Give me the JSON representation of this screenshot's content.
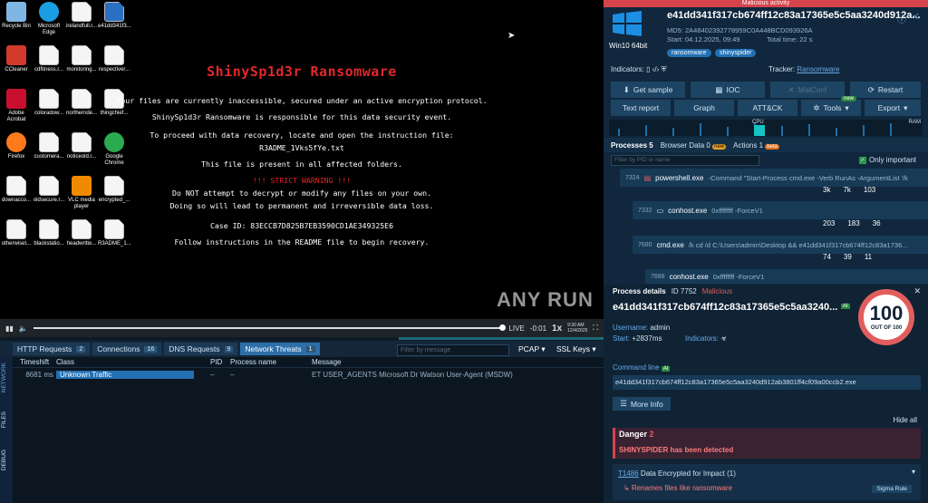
{
  "vm": {
    "icons": [
      {
        "label": "Recycle Bin",
        "name": "recycle-bin-icon",
        "color": "#7fb6e4"
      },
      {
        "label": "Microsoft Edge",
        "name": "edge-icon",
        "color": "#1b9de2"
      },
      {
        "label": "irelandfull.r...",
        "name": "file-icon",
        "color": "#ffffff"
      },
      {
        "label": "e41dd341f3...",
        "name": "file-icon",
        "color": "#2b6fc2"
      },
      {
        "label": "CCleaner",
        "name": "ccleaner-icon",
        "color": "#d33a2c"
      },
      {
        "label": "cdfitness.r...",
        "name": "file-icon",
        "color": "#ffffff"
      },
      {
        "label": "monitoring...",
        "name": "file-icon",
        "color": "#ffffff"
      },
      {
        "label": "respectiver...",
        "name": "file-icon",
        "color": "#ffffff"
      },
      {
        "label": "Adobe Acrobat",
        "name": "acrobat-icon",
        "color": "#c8102e"
      },
      {
        "label": "coloradow...",
        "name": "file-icon",
        "color": "#ffffff"
      },
      {
        "label": "northernde...",
        "name": "file-icon",
        "color": "#ffffff"
      },
      {
        "label": "thingchief...",
        "name": "file-icon",
        "color": "#ffffff"
      },
      {
        "label": "Firefox",
        "name": "firefox-icon",
        "color": "#ff7a1a"
      },
      {
        "label": "customera...",
        "name": "file-icon",
        "color": "#ffffff"
      },
      {
        "label": "noticeold.r...",
        "name": "file-icon",
        "color": "#ffffff"
      },
      {
        "label": "Google Chrome",
        "name": "chrome-icon",
        "color": "#2bab4f"
      },
      {
        "label": "downacco...",
        "name": "file-icon",
        "color": "#ffffff"
      },
      {
        "label": "oldsecure.r...",
        "name": "file-icon",
        "color": "#ffffff"
      },
      {
        "label": "VLC media player",
        "name": "vlc-icon",
        "color": "#f08a00"
      },
      {
        "label": "encrypted_...",
        "name": "file-icon",
        "color": "#ffffff"
      },
      {
        "label": "otherwiset...",
        "name": "file-icon",
        "color": "#ffffff"
      },
      {
        "label": "blackstatio...",
        "name": "file-icon",
        "color": "#ffffff"
      },
      {
        "label": "headwritte...",
        "name": "file-icon",
        "color": "#ffffff"
      },
      {
        "label": "R3ADME_1...",
        "name": "file-icon",
        "color": "#ffffff"
      }
    ],
    "note": {
      "title": "ShinySp1d3r Ransomware",
      "l1": "Your files are currently inaccessible, secured under an active encryption protocol.",
      "l2": "ShinySp1d3r Ransomware is responsible for this data security event.",
      "l3": "To proceed with data recovery, locate and open the instruction file:",
      "l4": "R3ADME_1Vks5fYe.txt",
      "l5": "This file is present in all affected folders.",
      "l6": "!!! STRICT WARNING !!!",
      "l7": "Do NOT attempt to decrypt or modify any files on your own.",
      "l8": "Doing so will lead to permanent and irreversible data loss.",
      "l9": "Case ID: 83ECCB7D825B7EB3590CD1AE349325E6",
      "l10": "Follow instructions in the README file to begin recovery."
    },
    "watermark": "ANY RUN",
    "player": {
      "live": "LIVE",
      "time": "-0:01",
      "speed": "1x",
      "clock_time": "9:30 AM",
      "clock_date": "12/4/2025"
    }
  },
  "bottom": {
    "tabs": [
      {
        "label": "HTTP Requests",
        "count": "2"
      },
      {
        "label": "Connections",
        "count": "16"
      },
      {
        "label": "DNS Requests",
        "count": "9"
      },
      {
        "label": "Network Threats",
        "count": "1"
      }
    ],
    "filter_placeholder": "Filter by message",
    "pcap": "PCAP",
    "sslkeys": "SSL Keys",
    "side": [
      "NETWORK",
      "FILES",
      "DEBUG"
    ],
    "cols": [
      "Timeshift",
      "Class",
      "PID",
      "Process name",
      "Message"
    ],
    "row": {
      "time": "8681 ms",
      "class": "Unknown Traffic",
      "pid": "–",
      "proc": "–",
      "msg": "ET USER_AGENTS Microsoft Dr Watson User-Agent (MSDW)"
    }
  },
  "right": {
    "banner": "Malicious activity",
    "os": "Win10 64bit",
    "hash": "e41dd341f317cb674ff12c83a17365e5c5aa3240d912a...",
    "md5": "MD5: 2A48402392778959C0A448BCD093926A",
    "start": "Start: 04.12.2025, 09:49",
    "total": "Total time: 22 s",
    "tags": [
      "ransomware",
      "shinyspider"
    ],
    "indicators": "Indicators:",
    "tracker_label": "Tracker:",
    "tracker": "Ransomware",
    "buttons": {
      "get_sample": "Get sample",
      "ioc": "IOC",
      "malconf": "MalConf",
      "restart": "Restart",
      "text_report": "Text report",
      "graph": "Graph",
      "attck": "ATT&CK",
      "tools": "Tools",
      "new": "new",
      "export": "Export"
    },
    "cpu": "CPU",
    "ram": "RAM",
    "ptabs": {
      "processes": "Processes",
      "processes_n": "5",
      "browser": "Browser Data",
      "browser_n": "0",
      "browser_badge": "new",
      "actions": "Actions",
      "actions_n": "1",
      "actions_badge": "beta"
    },
    "pid_filter": "Filter by PID or name",
    "only_important": "Only important",
    "procs": [
      {
        "pid": "7324",
        "name": "powershell.exe",
        "args": "-Command \"Start-Process cmd.exe -Verb RunAs -ArgumentList '/k",
        "s1": "3k",
        "s2": "7k",
        "s3": "103"
      },
      {
        "pid": "7332",
        "name": "conhost.exe",
        "args": "0xffffffff -ForceV1",
        "s1": "203",
        "s2": "183",
        "s3": "36"
      },
      {
        "pid": "7680",
        "name": "cmd.exe",
        "args": "/k cd /d C:\\Users\\admin\\Desktop && e41dd341f317cb674ff12c83a1736...",
        "s1": "74",
        "s2": "39",
        "s3": "11"
      },
      {
        "pid": "7688",
        "name": "conhost.exe",
        "args": "0xffffffff -ForceV1"
      }
    ],
    "details": {
      "title": "Process details",
      "id": "ID 7752",
      "status": "Malicious",
      "name": "e41dd341f317cb674ff12c83a17365e5c5aa3240...",
      "ai": "AI",
      "username": "Username:",
      "user": "admin",
      "start": "Start:",
      "start_v": "+2837ms",
      "indicators": "Indicators:",
      "score": "100",
      "out_of": "OUT OF 100",
      "cmd_label": "Command line",
      "cmd": "e41dd341f317cb674ff12c83a17365e5c5aa3240d912ab3801ff4cf09a00ccb2.exe",
      "more": "More Info",
      "hide": "Hide all",
      "danger": "Danger",
      "danger_n": "2",
      "detected": "SHINYSPIDER has been detected",
      "technique": "T1486",
      "technique_text": "Data Encrypted for Impact (1)",
      "renames": "Renames files like ransomware",
      "sigma": "Sigma Rule"
    }
  }
}
